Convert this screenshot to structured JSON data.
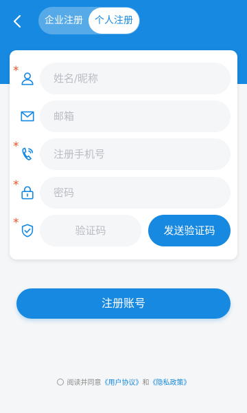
{
  "header": {
    "back_icon": "chevron-left-icon",
    "tabs": [
      {
        "label": "企业注册",
        "active": false
      },
      {
        "label": "个人注册",
        "active": true
      }
    ]
  },
  "form": {
    "name": {
      "placeholder": "姓名/昵称",
      "required": true,
      "icon": "user-icon"
    },
    "email": {
      "placeholder": "邮箱",
      "required": false,
      "icon": "mail-icon"
    },
    "phone": {
      "placeholder": "注册手机号",
      "required": true,
      "icon": "phone-icon"
    },
    "password": {
      "placeholder": "密码",
      "required": true,
      "icon": "lock-icon"
    },
    "code": {
      "placeholder": "验证码",
      "required": true,
      "icon": "shield-check-icon"
    },
    "required_mark": "*",
    "send_code_label": "发送验证码"
  },
  "submit_label": "注册账号",
  "agreement": {
    "prefix": "阅读并同意",
    "user_agreement": "《用户协议》",
    "and": "和",
    "privacy_policy": "《隐私政策》"
  },
  "colors": {
    "primary": "#1789e0",
    "required": "#e8552d",
    "background": "#f5f6f7"
  }
}
